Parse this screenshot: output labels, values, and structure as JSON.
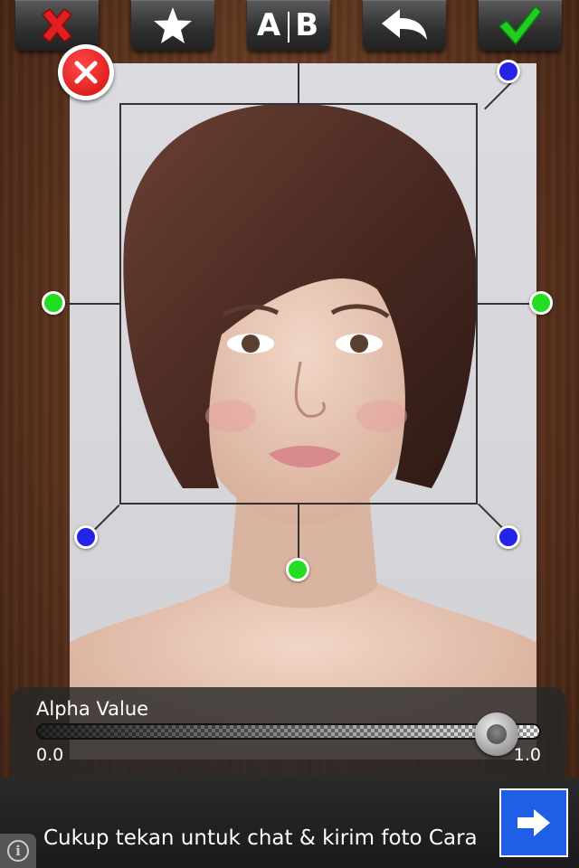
{
  "toolbar": {
    "buttons": [
      {
        "icon": "close-icon",
        "color": "#e02020"
      },
      {
        "icon": "star-icon",
        "color": "#ffffff"
      },
      {
        "icon": "ab-compare-icon",
        "label_a": "A",
        "label_b": "B"
      },
      {
        "icon": "undo-icon",
        "color": "#ffffff"
      },
      {
        "icon": "checkmark-icon",
        "color": "#22cc22"
      }
    ]
  },
  "editor": {
    "remove_icon": "close-circle-icon",
    "handle_colors": {
      "corner": "#2424e6",
      "edge": "#22dd22"
    }
  },
  "alpha": {
    "label": "Alpha Value",
    "min_label": "0.0",
    "max_label": "1.0",
    "value": 0.95
  },
  "ad": {
    "text": "Cukup tekan untuk chat & kirim foto Cara",
    "arrow_icon": "arrow-right-icon",
    "info_icon": "info-icon",
    "info_glyph": "i"
  }
}
